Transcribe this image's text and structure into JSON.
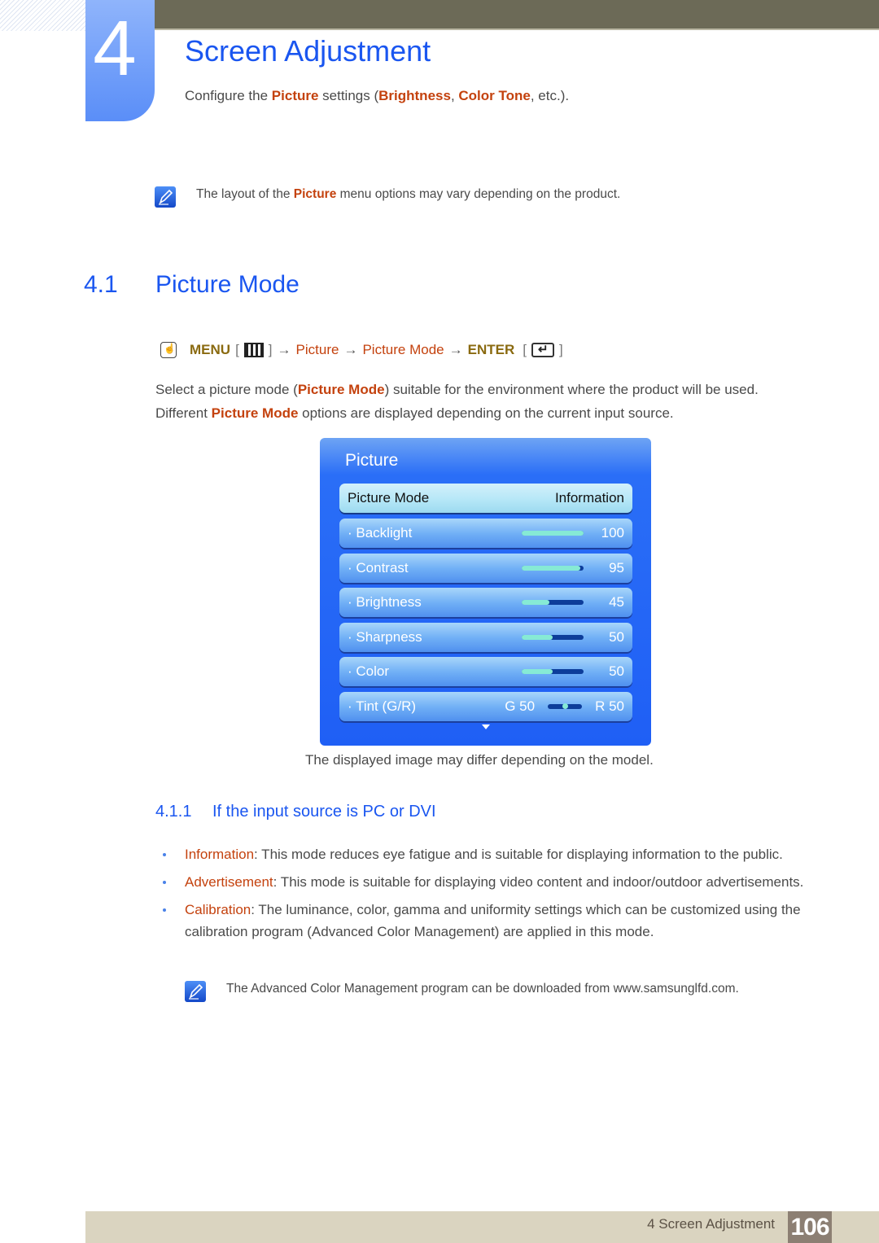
{
  "chapter": {
    "number": "4",
    "title": "Screen Adjustment",
    "intro": {
      "prefix": "Configure the ",
      "picture": "Picture",
      "middle": " settings (",
      "brightness": "Brightness",
      "comma": ", ",
      "color_tone": "Color Tone",
      "suffix": ", etc.)."
    }
  },
  "note1": {
    "icon": "note-pencil-icon",
    "prefix": "The layout of the ",
    "highlight": "Picture",
    "suffix": " menu options may vary depending on the product."
  },
  "section": {
    "number": "4.1",
    "title": "Picture Mode"
  },
  "menu_path": {
    "icon": "remote-hand-icon",
    "menu": "MENU",
    "open_bracket": "[",
    "close_bracket": "]",
    "arrow": "→",
    "step1": "Picture",
    "step2": "Picture Mode",
    "enter": "ENTER"
  },
  "paragraph": {
    "line1_prefix": "Select a picture mode (",
    "line1_highlight": "Picture Mode",
    "line1_suffix": ") suitable for the environment where the product will be used.",
    "line2_prefix": "Different ",
    "line2_highlight": "Picture Mode",
    "line2_suffix": " options are displayed depending on the current input source."
  },
  "osd": {
    "title": "Picture",
    "selected": {
      "label": "Picture Mode",
      "value": "Information"
    },
    "rows": [
      {
        "label": "· Backlight",
        "value": "100",
        "level": 100
      },
      {
        "label": "· Contrast",
        "value": "95",
        "level": 95
      },
      {
        "label": "· Brightness",
        "value": "45",
        "level": 45
      },
      {
        "label": "· Sharpness",
        "value": "50",
        "level": 50
      },
      {
        "label": "· Color",
        "value": "50",
        "level": 50
      }
    ],
    "tint": {
      "label": "· Tint (G/R)",
      "g": "G 50",
      "r": "R 50",
      "balance": 50
    },
    "more_icon": "triangle-down-icon"
  },
  "caption": "The displayed image may differ depending on the model.",
  "subsection": {
    "number": "4.1.1",
    "title": "If the input source is PC or DVI"
  },
  "bullets": [
    {
      "term": "Information",
      "text": ": This mode reduces eye fatigue and is suitable for displaying information to the public."
    },
    {
      "term": "Advertisement",
      "text": ": This mode is suitable for displaying video content and indoor/outdoor advertisements."
    },
    {
      "term": "Calibration",
      "text": ": The luminance, color, gamma and uniformity settings which can be customized using the calibration program (Advanced Color Management) are applied in this mode."
    }
  ],
  "note2": {
    "icon": "note-pencil-icon",
    "text": "The Advanced Color Management program can be downloaded from www.samsunglfd.com."
  },
  "footer": {
    "chapter_label": "4 Screen Adjustment",
    "page_number": "106"
  },
  "colors": {
    "heading_blue": "#1a56f0",
    "highlight_orange": "#c4420e",
    "highlight_olive": "#8a6a10",
    "top_bar": "#6c6a57",
    "footer_bar": "#dad4c0",
    "page_badge": "#8c7f73"
  }
}
